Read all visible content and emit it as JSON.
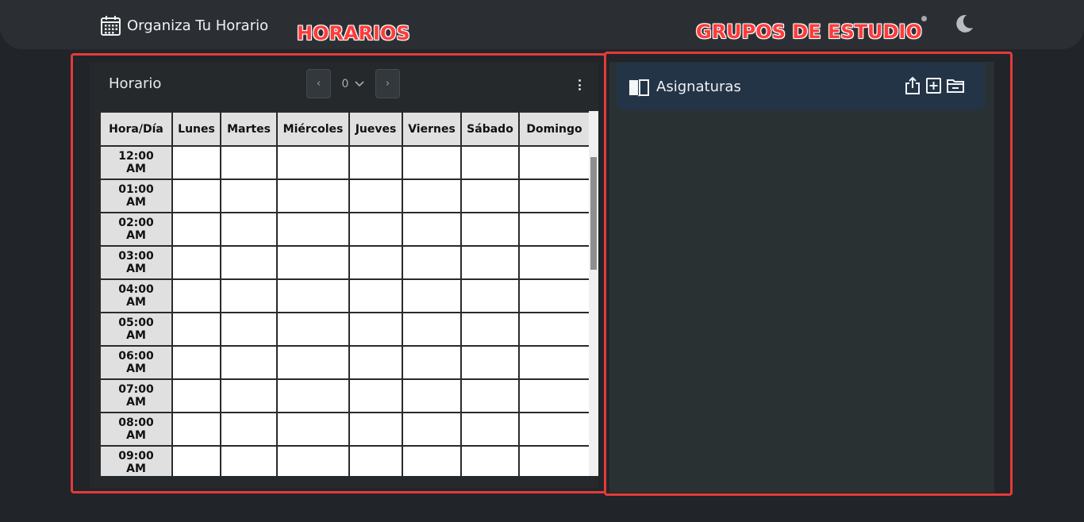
{
  "app": {
    "title": "Organiza Tu Horario"
  },
  "annotations": {
    "horarios": "HORARIOS",
    "grupos": "GRUPOS DE ESTUDIO"
  },
  "icons": {
    "brand": "calendar-icon",
    "theme": "moon-icon",
    "menu": "kebab-icon",
    "subjects": "book-icon",
    "export": "upload-icon",
    "add": "plus-square-icon",
    "folder": "folder-minus-icon"
  },
  "colors": {
    "navbar": "#2b2f33",
    "background": "#212428",
    "annotation_red": "#e53a3a",
    "subjects_bar": "#243447"
  },
  "schedule": {
    "title": "Horario",
    "pager": {
      "prev": "‹",
      "next": "›",
      "selected": "0"
    },
    "columns": [
      "Hora/Día",
      "Lunes",
      "Martes",
      "Miércoles",
      "Jueves",
      "Viernes",
      "Sábado",
      "Domingo"
    ],
    "hours": [
      "12:00 AM",
      "01:00 AM",
      "02:00 AM",
      "03:00 AM",
      "04:00 AM",
      "05:00 AM",
      "06:00 AM",
      "07:00 AM",
      "08:00 AM",
      "09:00 AM"
    ]
  },
  "groups": {
    "subjects_label": "Asignaturas"
  }
}
